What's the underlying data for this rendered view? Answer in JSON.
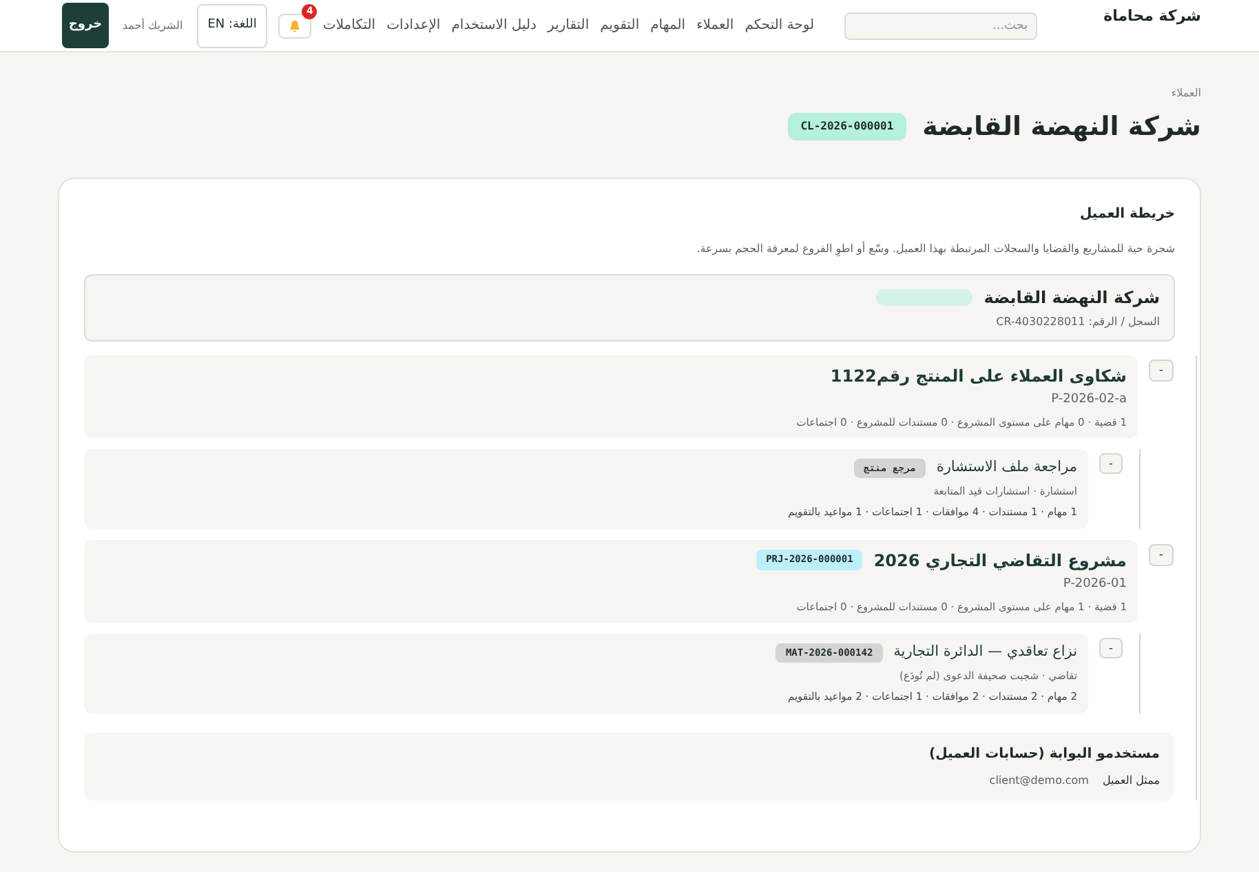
{
  "nav": {
    "brand": "شركة محاماة",
    "search": {
      "placeholder": "بحث..."
    },
    "links": [
      "لوحة التحكم",
      "العملاء",
      "المهام",
      "التقويم",
      "التقارير",
      "دليل الاستخدام",
      "الإعدادات",
      "التكاملات"
    ],
    "notifications": "4",
    "language": "اللغة: EN",
    "user": "الشريك أحمد",
    "logout": "خروج"
  },
  "breadcrumb": "العملاء",
  "title": "شركة النهضة القابضة",
  "title_code": "CL-2026-000001",
  "map": {
    "heading": "خريطة العميل",
    "description": "شجرة حية للمشاريع والقضايا والسجلات المرتبطة بهذا العميل. وسّع أو اطوِ الفروع لمعرفة الحجم بسرعة.",
    "root": {
      "name": "شركة النهضة القابضة",
      "registry": "السجل / الرقم: CR-4030228011"
    },
    "projects": [
      {
        "toggle": "-",
        "title": "شكاوى العملاء على المنتج رقم1122",
        "ref": "P-2026-02-a",
        "stats": "1 قضية · 0 مهام على مستوى المشروع · 0 مستندات للمشروع · 0 اجتماعات",
        "children": [
          {
            "toggle": "-",
            "title": "مراجعة ملف الاستشارة",
            "tag": "مرجع منتج",
            "color": "#d4d4d4",
            "subtitle": "استشارة · استشارات قيد المتابعة",
            "stats": "1 مهام · 1 مستندات · 4 موافقات · 1 اجتماعات · 1 مواعيد بالتقويم"
          }
        ]
      },
      {
        "toggle": "-",
        "title": "مشروع التقاضي التجاري 2026",
        "tag": "PRJ-2026-000001",
        "color": "#bdeefa",
        "ref": "P-2026-01",
        "stats": "1 قضية · 1 مهام على مستوى المشروع · 0 مستندات للمشروع · 0 اجتماعات",
        "children": [
          {
            "toggle": "-",
            "title": "نزاع تعاقدي — الدائرة التجارية",
            "tag": "MAT-2026-000142",
            "color": "#d4d4d4",
            "subtitle": "تقاضي · شجبت صحيفة الدعوى (لم تُودَع)",
            "stats": "2 مهام · 2 مستندات · 2 موافقات · 1 اجتماعات · 2 مواعيد بالتقويم"
          }
        ]
      }
    ],
    "portal": {
      "title": "مستخدمو البوابة (حسابات العميل)",
      "users": [
        {
          "role": "ممثل العميل",
          "email": "client@demo.com"
        }
      ]
    }
  }
}
